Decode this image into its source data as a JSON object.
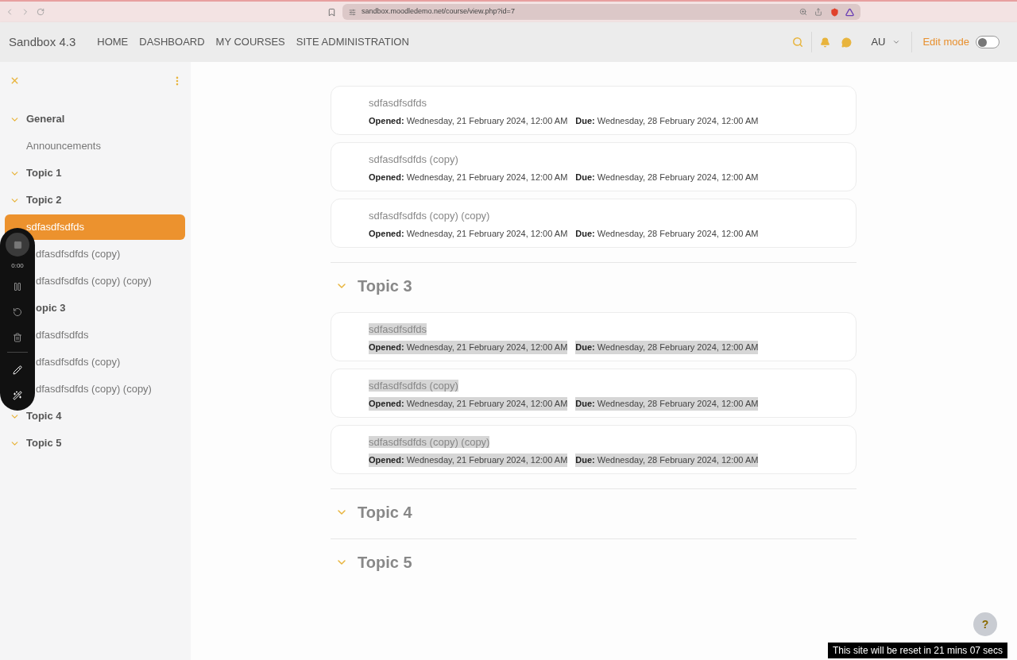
{
  "browser": {
    "url": "sandbox.moodledemo.net/course/view.php?id=7"
  },
  "navbar": {
    "brand": "Sandbox 4.3",
    "links": [
      "HOME",
      "DASHBOARD",
      "MY COURSES",
      "SITE ADMINISTRATION"
    ],
    "user": "AU",
    "edit_mode": {
      "label": "Edit mode",
      "on": false
    }
  },
  "sidebar": {
    "sections": [
      {
        "title": "General",
        "expanded": true,
        "items": [
          {
            "label": "Announcements",
            "selected": false
          }
        ]
      },
      {
        "title": "Topic 1",
        "expanded": true
      },
      {
        "title": "Topic 2",
        "expanded": true,
        "items": [
          {
            "label": "sdfasdfsdfds",
            "selected": true
          },
          {
            "label": "dfasdfsdfds (copy)",
            "selected": false
          },
          {
            "label": "dfasdfsdfds (copy) (copy)",
            "selected": false
          }
        ]
      },
      {
        "title": "opic 3",
        "items": [
          {
            "label": "dfasdfsdfds",
            "selected": false
          },
          {
            "label": "dfasdfsdfds (copy)",
            "selected": false
          },
          {
            "label": "dfasdfsdfds (copy) (copy)",
            "selected": false
          }
        ]
      },
      {
        "title": "Topic 4",
        "expanded": true
      },
      {
        "title": "Topic 5",
        "expanded": true
      }
    ]
  },
  "recorder": {
    "time": "0:00"
  },
  "course": {
    "sections": [
      {
        "activities": [
          {
            "name": "sdfasdfsdfds",
            "opened_label": "Opened:",
            "opened": "Wednesday, 21 February 2024, 12:00 AM",
            "due_label": "Due:",
            "due": "Wednesday, 28 February 2024, 12:00 AM",
            "highlighted": false
          },
          {
            "name": "sdfasdfsdfds (copy)",
            "opened_label": "Opened:",
            "opened": "Wednesday, 21 February 2024, 12:00 AM",
            "due_label": "Due:",
            "due": "Wednesday, 28 February 2024, 12:00 AM",
            "highlighted": false
          },
          {
            "name": "sdfasdfsdfds (copy) (copy)",
            "opened_label": "Opened:",
            "opened": "Wednesday, 21 February 2024, 12:00 AM",
            "due_label": "Due:",
            "due": "Wednesday, 28 February 2024, 12:00 AM",
            "highlighted": false
          }
        ]
      },
      {
        "title": "Topic 3",
        "expanded": true,
        "activities": [
          {
            "name": "sdfasdfsdfds",
            "opened_label": "Opened:",
            "opened": "Wednesday, 21 February 2024, 12:00 AM",
            "due_label": "Due:",
            "due": "Wednesday, 28 February 2024, 12:00 AM",
            "highlighted": true
          },
          {
            "name": "sdfasdfsdfds (copy)",
            "opened_label": "Opened:",
            "opened": "Wednesday, 21 February 2024, 12:00 AM",
            "due_label": "Due:",
            "due": "Wednesday, 28 February 2024, 12:00 AM",
            "highlighted": true
          },
          {
            "name": "sdfasdfsdfds (copy) (copy)",
            "opened_label": "Opened:",
            "opened": "Wednesday, 21 February 2024, 12:00 AM",
            "due_label": "Due:",
            "due": "Wednesday, 28 February 2024, 12:00 AM",
            "highlighted": true
          }
        ]
      },
      {
        "title": "Topic 4",
        "expanded": true
      },
      {
        "title": "Topic 5",
        "expanded": true
      }
    ]
  },
  "help": {
    "label": "?"
  },
  "reset_notice": "This site will be reset in 21 mins 07 secs"
}
